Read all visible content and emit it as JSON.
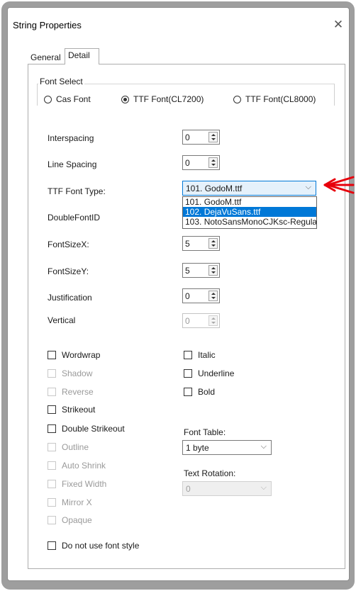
{
  "dialog": {
    "title": "String Properties"
  },
  "tabs": [
    {
      "label": "General"
    },
    {
      "label": "Detail"
    }
  ],
  "font_select": {
    "label": "Font Select",
    "options": [
      "Cas Font",
      "TTF Font(CL7200)",
      "TTF Font(CL8000)"
    ],
    "selected": "TTF Font(CL7200)"
  },
  "fields": {
    "interspacing": {
      "label": "Interspacing",
      "value": "0"
    },
    "line_spacing": {
      "label": "Line Spacing",
      "value": "0"
    },
    "ttf_font_type": {
      "label": "TTF Font Type:",
      "value": "101. GodoM.ttf"
    },
    "double_font_id": {
      "label": "DoubleFontID"
    },
    "font_size_x": {
      "label": "FontSizeX:",
      "value": "5"
    },
    "font_size_y": {
      "label": "FontSizeY:",
      "value": "5"
    },
    "justification": {
      "label": "Justification",
      "value": "0"
    },
    "vertical": {
      "label": "Vertical",
      "value": "0"
    }
  },
  "font_dropdown": {
    "items": [
      "101. GodoM.ttf",
      "102. DejaVuSans.ttf",
      "103. NotoSansMonoCJKsc-Regular.otf"
    ],
    "highlighted": "102. DejaVuSans.ttf"
  },
  "checkboxes_left": [
    {
      "label": "Wordwrap",
      "enabled": true
    },
    {
      "label": "Shadow",
      "enabled": false
    },
    {
      "label": "Reverse",
      "enabled": false
    },
    {
      "label": "Strikeout",
      "enabled": true
    },
    {
      "label": "Double Strikeout",
      "enabled": true
    },
    {
      "label": "Outline",
      "enabled": false
    },
    {
      "label": "Auto Shrink",
      "enabled": false
    },
    {
      "label": "Fixed Width",
      "enabled": false
    },
    {
      "label": "Mirror X",
      "enabled": false
    },
    {
      "label": "Opaque",
      "enabled": false
    }
  ],
  "checkboxes_right": [
    {
      "label": "Italic",
      "enabled": true
    },
    {
      "label": "Underline",
      "enabled": true
    },
    {
      "label": "Bold",
      "enabled": true
    }
  ],
  "font_table": {
    "label": "Font Table:",
    "value": "1 byte"
  },
  "text_rotation": {
    "label": "Text Rotation:",
    "value": "0"
  },
  "no_font_style": {
    "label": "Do not use font style"
  },
  "colors": {
    "accent": "#0078d7",
    "annotation_arrow": "#e8000b"
  },
  "annotation": {
    "icon": "red-arrow-icon"
  }
}
